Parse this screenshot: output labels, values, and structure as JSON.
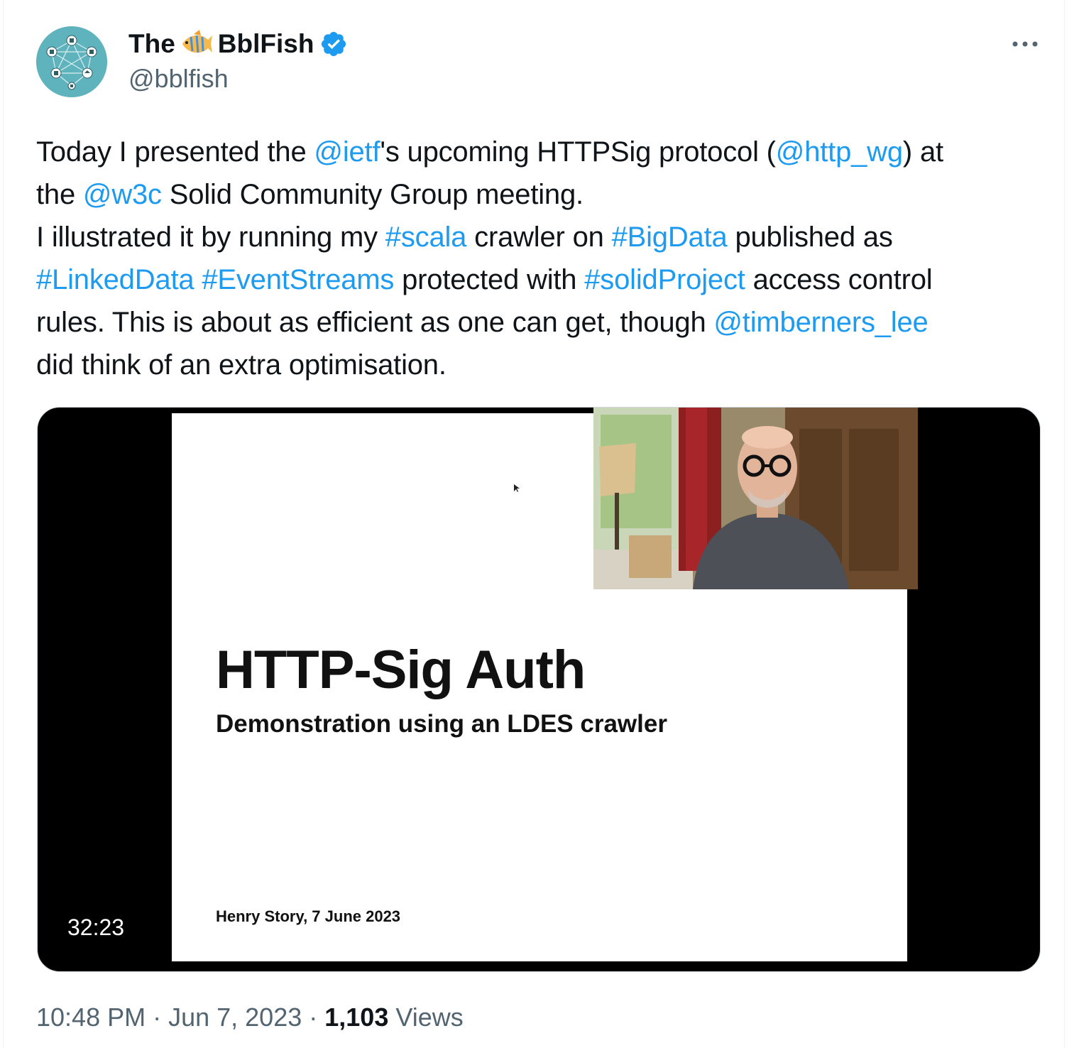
{
  "author": {
    "name_prefix": "The",
    "name_suffix": "BblFish",
    "handle": "@bblfish",
    "verified": true,
    "name_emoji": "tropical-fish-icon",
    "badge_color": "#1d9bf0"
  },
  "tweet": {
    "lines": [
      [
        {
          "t": "Today I presented the ",
          "link": false
        },
        {
          "t": "@ietf",
          "link": true
        },
        {
          "t": "'s upcoming HTTPSig protocol (",
          "link": false
        },
        {
          "t": "@http_wg",
          "link": true
        },
        {
          "t": ") at",
          "link": false
        }
      ],
      [
        {
          "t": "the ",
          "link": false
        },
        {
          "t": "@w3c",
          "link": true
        },
        {
          "t": " Solid Community Group meeting.",
          "link": false
        }
      ],
      [
        {
          "t": "I illustrated it by running my ",
          "link": false
        },
        {
          "t": "#scala",
          "link": true
        },
        {
          "t": " crawler on ",
          "link": false
        },
        {
          "t": "#BigData",
          "link": true
        },
        {
          "t": "  published as",
          "link": false
        }
      ],
      [
        {
          "t": "#LinkedData",
          "link": true
        },
        {
          "t": " ",
          "link": false
        },
        {
          "t": "#EventStreams",
          "link": true
        },
        {
          "t": " protected with ",
          "link": false
        },
        {
          "t": "#solidProject",
          "link": true
        },
        {
          "t": " access control",
          "link": false
        }
      ],
      [
        {
          "t": "rules. This is about as efficient as one can get, though ",
          "link": false
        },
        {
          "t": "@timberners_lee",
          "link": true
        }
      ],
      [
        {
          "t": "did think of an extra optimisation.",
          "link": false
        }
      ]
    ]
  },
  "video": {
    "slide_title": "HTTP-Sig Auth",
    "slide_subtitle": "Demonstration using an LDES crawler",
    "slide_author": "Henry Story, 7 June 2023",
    "duration": "32:23"
  },
  "meta": {
    "time": "10:48 PM",
    "separator": "·",
    "date": "Jun 7, 2023",
    "views_count": "1,103",
    "views_label": "Views"
  },
  "colors": {
    "link": "#1d9bf0",
    "text": "#0f1419",
    "secondary": "#536471",
    "avatar_bg": "#5fb3bd"
  }
}
